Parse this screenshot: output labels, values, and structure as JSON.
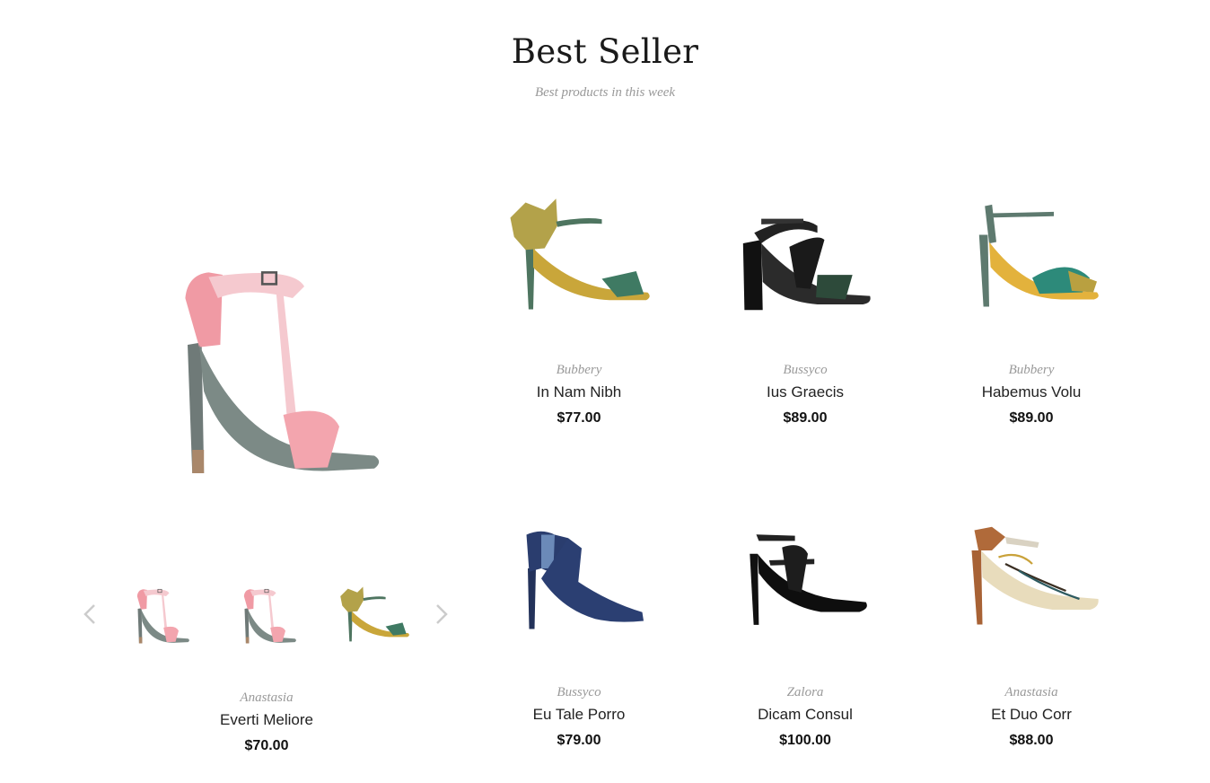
{
  "header": {
    "title": "Best Seller",
    "subtitle": "Best products in this week"
  },
  "featured": {
    "brand": "Anastasia",
    "name": "Everti Meliore",
    "price": "$70.00",
    "image_icon": "pink-t-strap-sandal",
    "thumbnails": [
      "pink-t-strap-sandal",
      "pink-t-strap-sandal",
      "olive-flower-sandal"
    ],
    "prev_icon": "chevron-left-icon",
    "next_icon": "chevron-right-icon"
  },
  "products": [
    {
      "brand": "Bubbery",
      "name": "In Nam Nibh",
      "price": "$77.00",
      "image_icon": "olive-flower-sandal"
    },
    {
      "brand": "Bussyco",
      "name": "Ius Graecis",
      "price": "$89.00",
      "image_icon": "black-strappy-block-heel"
    },
    {
      "brand": "Bubbery",
      "name": "Habemus Volu",
      "price": "$89.00",
      "image_icon": "green-ankle-strap-sandal"
    },
    {
      "brand": "Bussyco",
      "name": "Eu Tale Porro",
      "price": "$79.00",
      "image_icon": "navy-denim-pump"
    },
    {
      "brand": "Zalora",
      "name": "Dicam Consul",
      "price": "$100.00",
      "image_icon": "black-double-strap-pump"
    },
    {
      "brand": "Anastasia",
      "name": "Et Duo Corr",
      "price": "$88.00",
      "image_icon": "brown-patterned-slingback"
    }
  ],
  "colors": {
    "text": "#222222",
    "muted": "#999999",
    "arrow": "#cccccc"
  }
}
